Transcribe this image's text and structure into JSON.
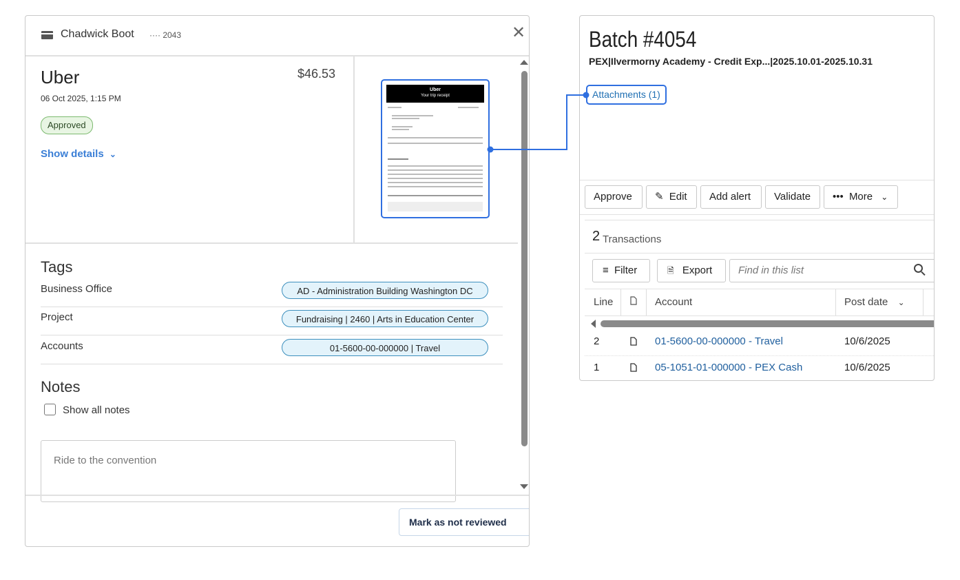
{
  "transaction": {
    "cardholder": "Chadwick Boot",
    "card_last4": "···· 2043",
    "merchant": "Uber",
    "amount": "$46.53",
    "date": "06 Oct 2025, 1:15 PM",
    "status": "Approved",
    "show_details": "Show details",
    "receipt": {
      "brand": "Uber",
      "subtitle": "Your trip receipt"
    },
    "tags_title": "Tags",
    "tags": [
      {
        "label": "Business Office",
        "value": "AD - Administration Building Washington DC"
      },
      {
        "label": "Project",
        "value": "Fundraising | 2460 | Arts in Education Center"
      },
      {
        "label": "Accounts",
        "value": "01-5600-00-000000 | Travel"
      }
    ],
    "notes_title": "Notes",
    "show_all_notes": "Show all notes",
    "note_text": "Ride to the convention",
    "mark_button": "Mark as not reviewed"
  },
  "batch": {
    "title": "Batch #4054",
    "subtitle": "PEX|Ilvermorny Academy - Credit Exp...|2025.10.01-2025.10.31",
    "attachments": "Attachments (1)",
    "toolbar": {
      "approve": "Approve",
      "edit": "Edit",
      "add_alert": "Add alert",
      "validate": "Validate",
      "more": "More"
    },
    "transactions_count": "2",
    "transactions_label": "Transactions",
    "filter": "Filter",
    "export": "Export",
    "search_placeholder": "Find in this list",
    "columns": {
      "line": "Line",
      "account": "Account",
      "post_date": "Post date"
    },
    "rows": [
      {
        "line": "2",
        "account": "01-5600-00-000000 - Travel",
        "post_date": "10/6/2025"
      },
      {
        "line": "1",
        "account": "05-1051-01-000000 - PEX Cash",
        "post_date": "10/6/2025"
      }
    ]
  },
  "colors": {
    "accent": "#2f6fe0",
    "link": "#1f5f9e",
    "approved_bg": "#e8f5e3",
    "tag_bg": "#e3f3fb"
  }
}
